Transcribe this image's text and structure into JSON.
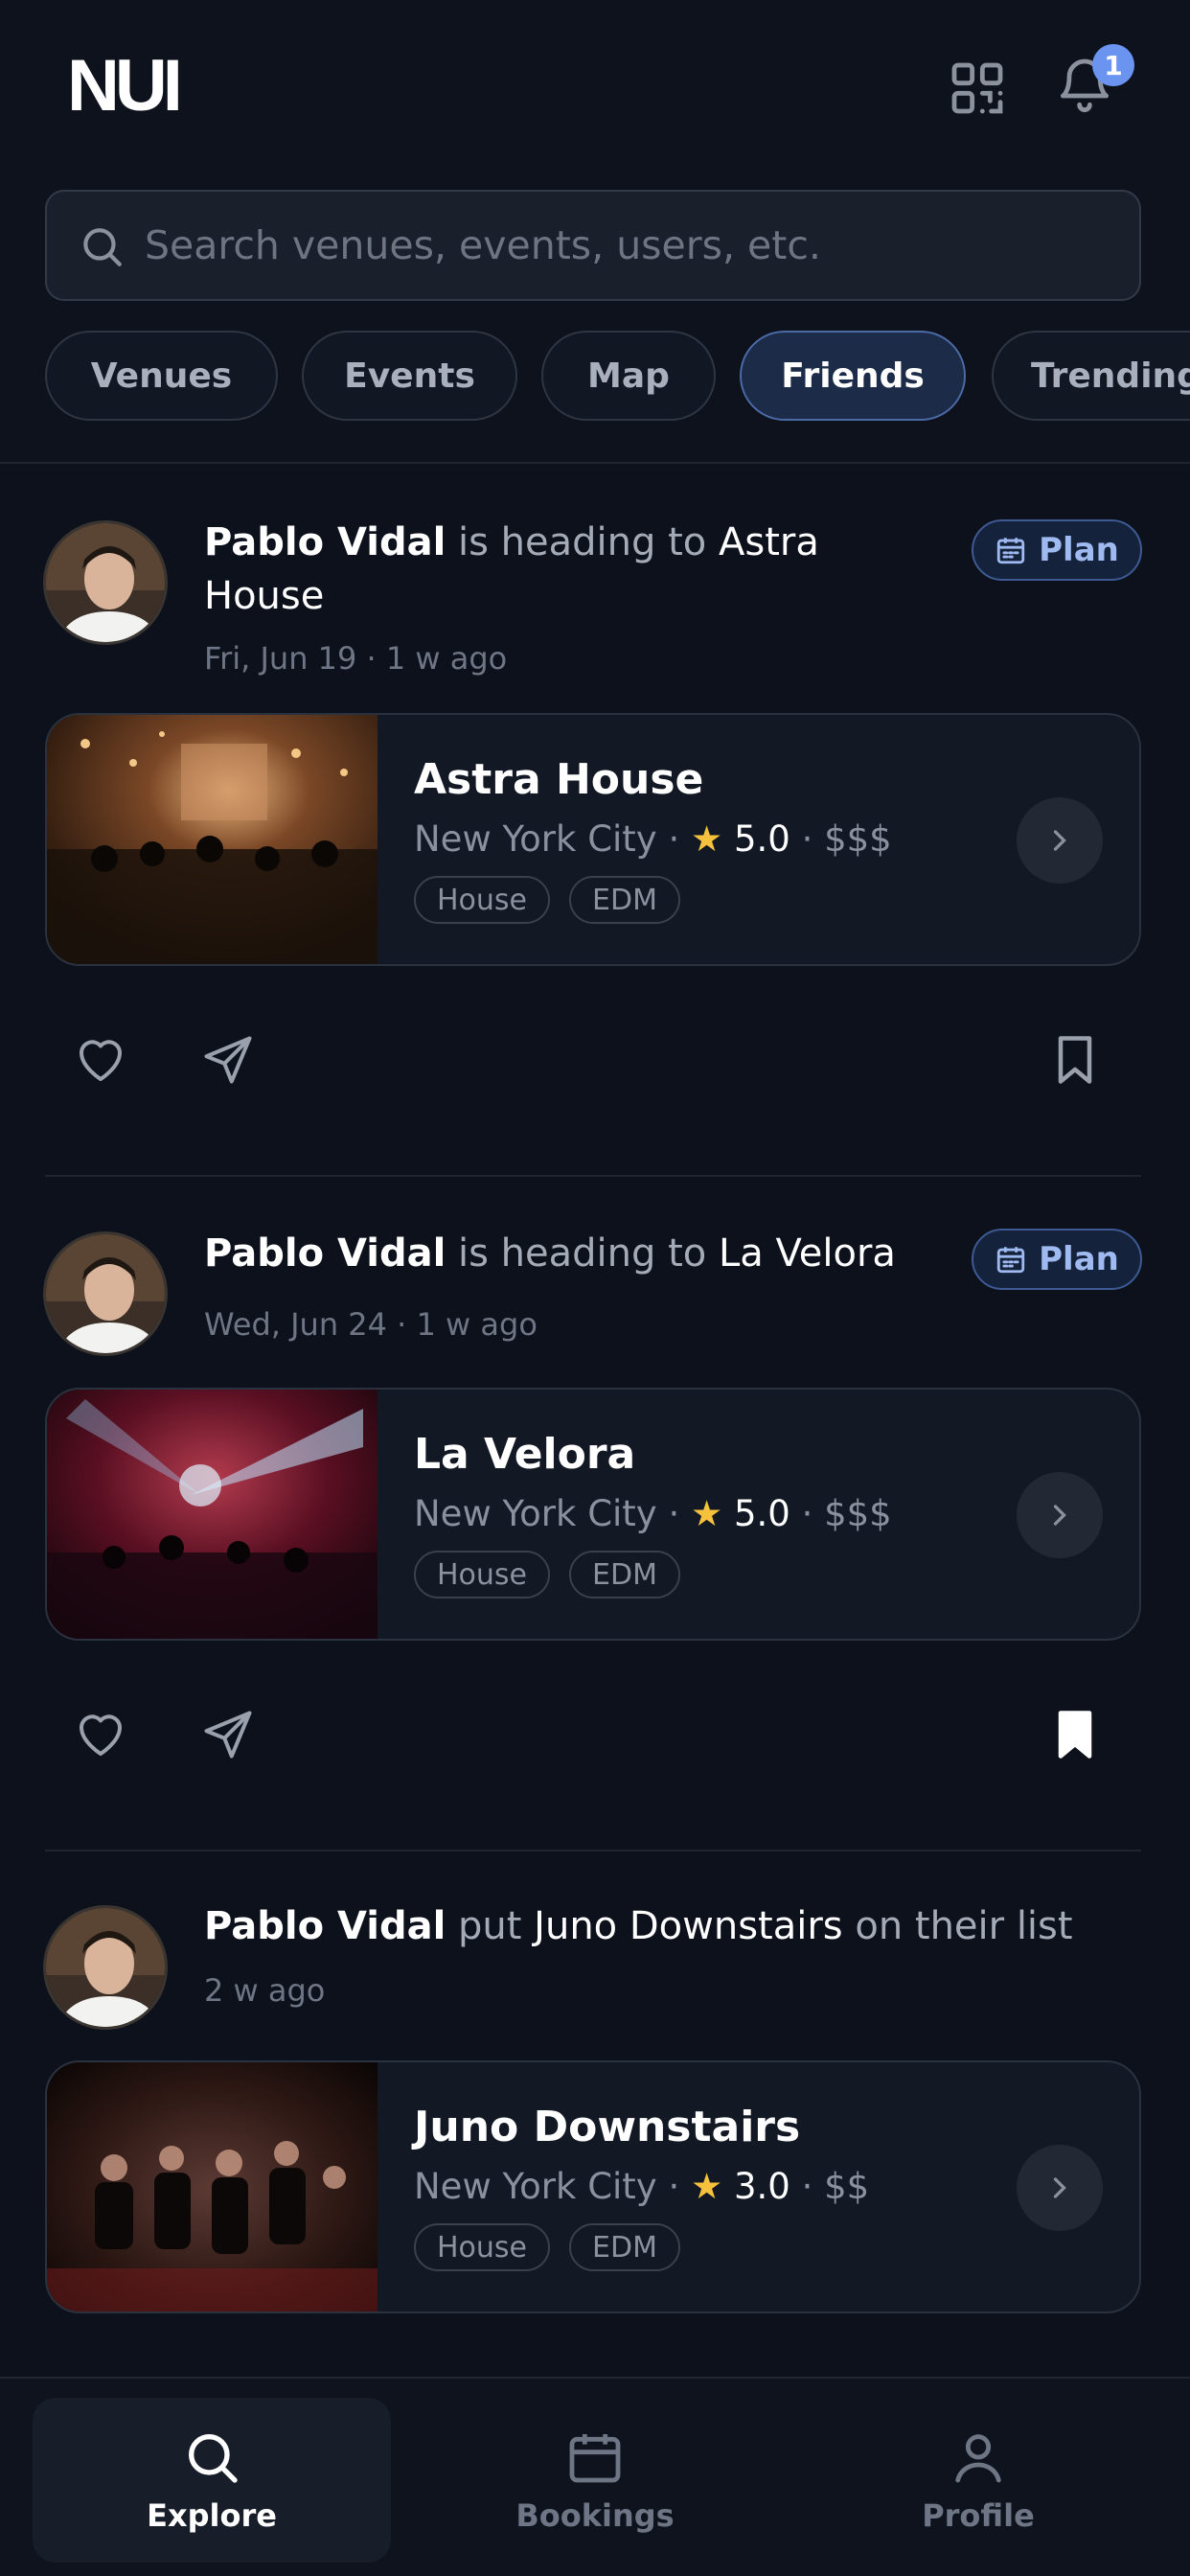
{
  "app": {
    "logo": "NUI"
  },
  "header": {
    "notification_count": "1"
  },
  "search": {
    "placeholder": "Search venues, events, users, etc."
  },
  "tabs": [
    {
      "label": "Venues",
      "active": false
    },
    {
      "label": "Events",
      "active": false
    },
    {
      "label": "Map",
      "active": false
    },
    {
      "label": "Friends",
      "active": true
    },
    {
      "label": "Trending",
      "active": false
    }
  ],
  "feed": [
    {
      "user": "Pablo Vidal",
      "action": "is heading to",
      "venue_ref": "Astra House",
      "time": "Fri, Jun 19 · 1 w ago",
      "plan_label": "Plan",
      "card": {
        "name": "Astra House",
        "city": "New York City",
        "rating": "5.0",
        "price": "$$$",
        "tags": [
          "House",
          "EDM"
        ]
      },
      "bookmarked": false
    },
    {
      "user": "Pablo Vidal",
      "action": "is heading to",
      "venue_ref": "La Velora",
      "time": "Wed, Jun 24 · 1 w ago",
      "plan_label": "Plan",
      "card": {
        "name": "La Velora",
        "city": "New York City",
        "rating": "5.0",
        "price": "$$$",
        "tags": [
          "House",
          "EDM"
        ]
      },
      "bookmarked": true
    },
    {
      "user": "Pablo Vidal",
      "action": "put",
      "venue_ref": "Juno Downstairs",
      "action_suffix": "on their list",
      "time": "2 w ago",
      "card": {
        "name": "Juno Downstairs",
        "city": "New York City",
        "rating": "3.0",
        "price": "$$",
        "tags": [
          "House",
          "EDM"
        ]
      }
    }
  ],
  "meta_sep": "·",
  "bottom_nav": [
    {
      "label": "Explore",
      "icon": "search-icon",
      "active": true
    },
    {
      "label": "Bookings",
      "icon": "calendar-icon",
      "active": false
    },
    {
      "label": "Profile",
      "icon": "user-icon",
      "active": false
    }
  ],
  "colors": {
    "background": "#0c111c",
    "accent": "#6b94f0",
    "star": "#f6c23e"
  }
}
